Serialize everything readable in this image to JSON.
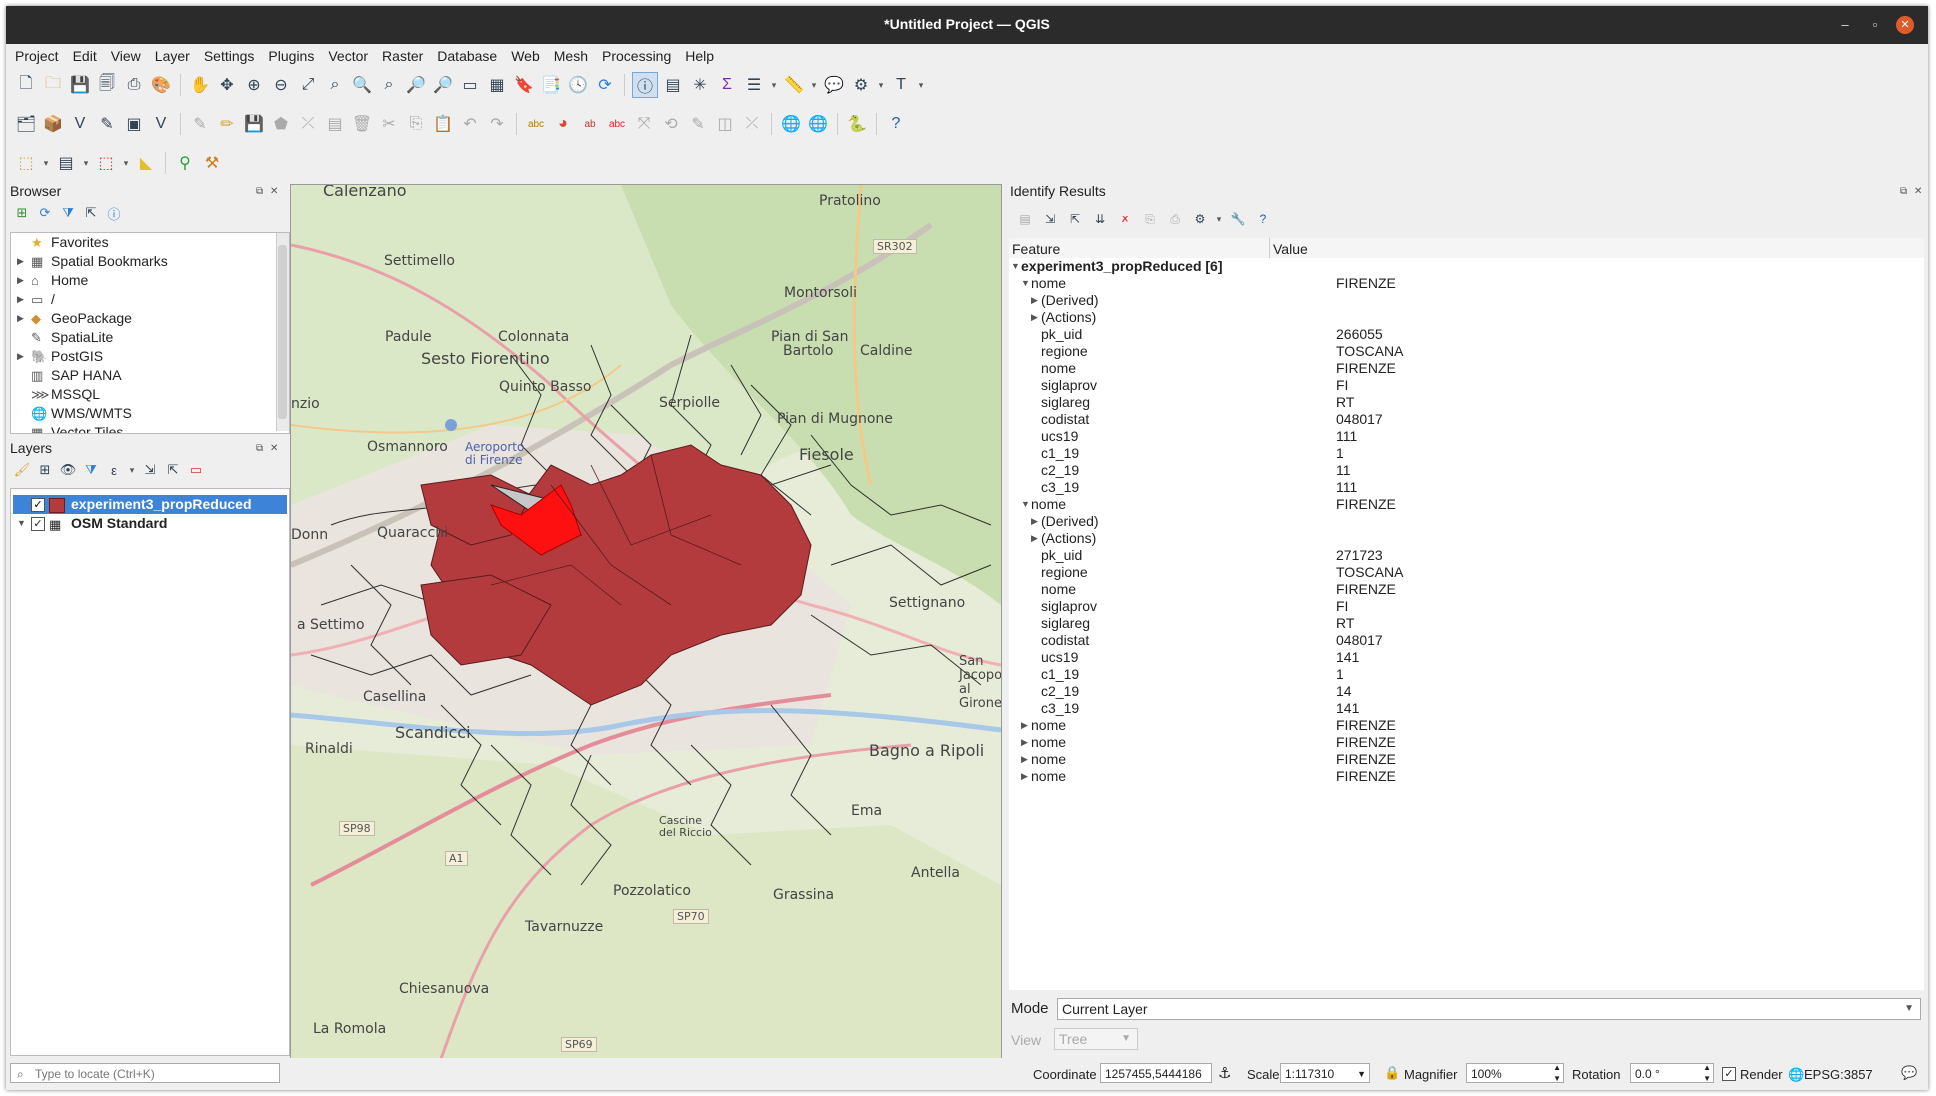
{
  "window": {
    "title": "*Untitled Project — QGIS"
  },
  "menu": [
    "Project",
    "Edit",
    "View",
    "Layer",
    "Settings",
    "Plugins",
    "Vector",
    "Raster",
    "Database",
    "Web",
    "Mesh",
    "Processing",
    "Help"
  ],
  "browser": {
    "title": "Browser",
    "items": [
      {
        "label": "Favorites",
        "icon": "star-icon",
        "expand": false
      },
      {
        "label": "Spatial Bookmarks",
        "icon": "bookmark-icon",
        "expand": true
      },
      {
        "label": "Home",
        "icon": "home-icon",
        "expand": true
      },
      {
        "label": "/",
        "icon": "folder-icon",
        "expand": true
      },
      {
        "label": "GeoPackage",
        "icon": "geopackage-icon",
        "expand": true
      },
      {
        "label": "SpatiaLite",
        "icon": "spatialite-icon",
        "expand": false
      },
      {
        "label": "PostGIS",
        "icon": "postgis-icon",
        "expand": true
      },
      {
        "label": "SAP HANA",
        "icon": "saphana-icon",
        "expand": false
      },
      {
        "label": "MSSQL",
        "icon": "mssql-icon",
        "expand": false
      },
      {
        "label": "WMS/WMTS",
        "icon": "wms-icon",
        "expand": false
      },
      {
        "label": "Vector Tiles",
        "icon": "vectortiles-icon",
        "expand": false
      }
    ]
  },
  "layers": {
    "title": "Layers",
    "items": [
      {
        "label": "experiment3_propReduced",
        "checked": true,
        "selected": true
      },
      {
        "label": "OSM Standard",
        "checked": true,
        "selected": false
      }
    ]
  },
  "map": {
    "labels": [
      {
        "t": "Calenzano"
      },
      {
        "t": "Pratolino"
      },
      {
        "t": "SR302"
      },
      {
        "t": "Settimello"
      },
      {
        "t": "Montorsoli"
      },
      {
        "t": "Padule"
      },
      {
        "t": "Colonnata"
      },
      {
        "t": "Pian di San"
      },
      {
        "t": "Bartolo"
      },
      {
        "t": "Caldine"
      },
      {
        "t": "Sesto Fiorentino"
      },
      {
        "t": "Quinto Basso"
      },
      {
        "t": "Serpiolle"
      },
      {
        "t": "nzio"
      },
      {
        "t": "Pian di Mugnone"
      },
      {
        "t": "Osmannoro"
      },
      {
        "t": "Aeroporto di Firenze"
      },
      {
        "t": "Fiesole"
      },
      {
        "t": "Donn"
      },
      {
        "t": "Quaracchi"
      },
      {
        "t": "Settignano"
      },
      {
        "t": "a Settimo"
      },
      {
        "t": "San Jacopo al Girone"
      },
      {
        "t": "Casellina"
      },
      {
        "t": "Scandicci"
      },
      {
        "t": "Rinaldi"
      },
      {
        "t": "Bagno a Ripoli"
      },
      {
        "t": "SP98"
      },
      {
        "t": "Ema"
      },
      {
        "t": "A1"
      },
      {
        "t": "Pozzolatico"
      },
      {
        "t": "Grassina"
      },
      {
        "t": "Antella"
      },
      {
        "t": "Tavarnuzze"
      },
      {
        "t": "SP70"
      },
      {
        "t": "Chiesanuova"
      },
      {
        "t": "La Romola"
      },
      {
        "t": "SP69"
      },
      {
        "t": "Cascine del Riccio"
      }
    ]
  },
  "identify": {
    "title": "Identify Results",
    "col_feature": "Feature",
    "col_value": "Value",
    "rows": [
      {
        "f": "experiment3_propReduced  [6]",
        "v": "",
        "lvl": 0,
        "arrow": "open",
        "bold": true
      },
      {
        "f": "nome",
        "v": "FIRENZE",
        "lvl": 1,
        "arrow": "open"
      },
      {
        "f": "(Derived)",
        "v": "",
        "lvl": 2,
        "arrow": "closed"
      },
      {
        "f": "(Actions)",
        "v": "",
        "lvl": 2,
        "arrow": "closed"
      },
      {
        "f": "pk_uid",
        "v": "266055",
        "lvl": 2
      },
      {
        "f": "regione",
        "v": "TOSCANA",
        "lvl": 2
      },
      {
        "f": "nome",
        "v": "FIRENZE",
        "lvl": 2
      },
      {
        "f": "siglaprov",
        "v": "FI",
        "lvl": 2
      },
      {
        "f": "siglareg",
        "v": "RT",
        "lvl": 2
      },
      {
        "f": "codistat",
        "v": "048017",
        "lvl": 2
      },
      {
        "f": "ucs19",
        "v": "111",
        "lvl": 2
      },
      {
        "f": "c1_19",
        "v": "1",
        "lvl": 2
      },
      {
        "f": "c2_19",
        "v": "11",
        "lvl": 2
      },
      {
        "f": "c3_19",
        "v": "111",
        "lvl": 2
      },
      {
        "f": "nome",
        "v": "FIRENZE",
        "lvl": 1,
        "arrow": "open"
      },
      {
        "f": "(Derived)",
        "v": "",
        "lvl": 2,
        "arrow": "closed"
      },
      {
        "f": "(Actions)",
        "v": "",
        "lvl": 2,
        "arrow": "closed"
      },
      {
        "f": "pk_uid",
        "v": "271723",
        "lvl": 2
      },
      {
        "f": "regione",
        "v": "TOSCANA",
        "lvl": 2
      },
      {
        "f": "nome",
        "v": "FIRENZE",
        "lvl": 2
      },
      {
        "f": "siglaprov",
        "v": "FI",
        "lvl": 2
      },
      {
        "f": "siglareg",
        "v": "RT",
        "lvl": 2
      },
      {
        "f": "codistat",
        "v": "048017",
        "lvl": 2
      },
      {
        "f": "ucs19",
        "v": "141",
        "lvl": 2
      },
      {
        "f": "c1_19",
        "v": "1",
        "lvl": 2
      },
      {
        "f": "c2_19",
        "v": "14",
        "lvl": 2
      },
      {
        "f": "c3_19",
        "v": "141",
        "lvl": 2
      },
      {
        "f": "nome",
        "v": "FIRENZE",
        "lvl": 1,
        "arrow": "closed"
      },
      {
        "f": "nome",
        "v": "FIRENZE",
        "lvl": 1,
        "arrow": "closed"
      },
      {
        "f": "nome",
        "v": "FIRENZE",
        "lvl": 1,
        "arrow": "closed"
      },
      {
        "f": "nome",
        "v": "FIRENZE",
        "lvl": 1,
        "arrow": "closed"
      }
    ],
    "mode_label": "Mode",
    "mode_value": "Current Layer",
    "view_label": "View",
    "view_value": "Tree"
  },
  "status": {
    "locate_placeholder": "Type to locate (Ctrl+K)",
    "coordinate_label": "Coordinate",
    "coordinate_value": "1257455,5444186",
    "scale_label": "Scale",
    "scale_value": "1:117310",
    "magnifier_label": "Magnifier",
    "magnifier_value": "100%",
    "rotation_label": "Rotation",
    "rotation_value": "0.0 °",
    "render_label": "Render",
    "crs": "EPSG:3857"
  },
  "colors": {
    "accent": "#3d83d8",
    "feature_fill": "#b33b3e",
    "highlight": "#ff1010",
    "titlebar": "#2b2b2b"
  }
}
